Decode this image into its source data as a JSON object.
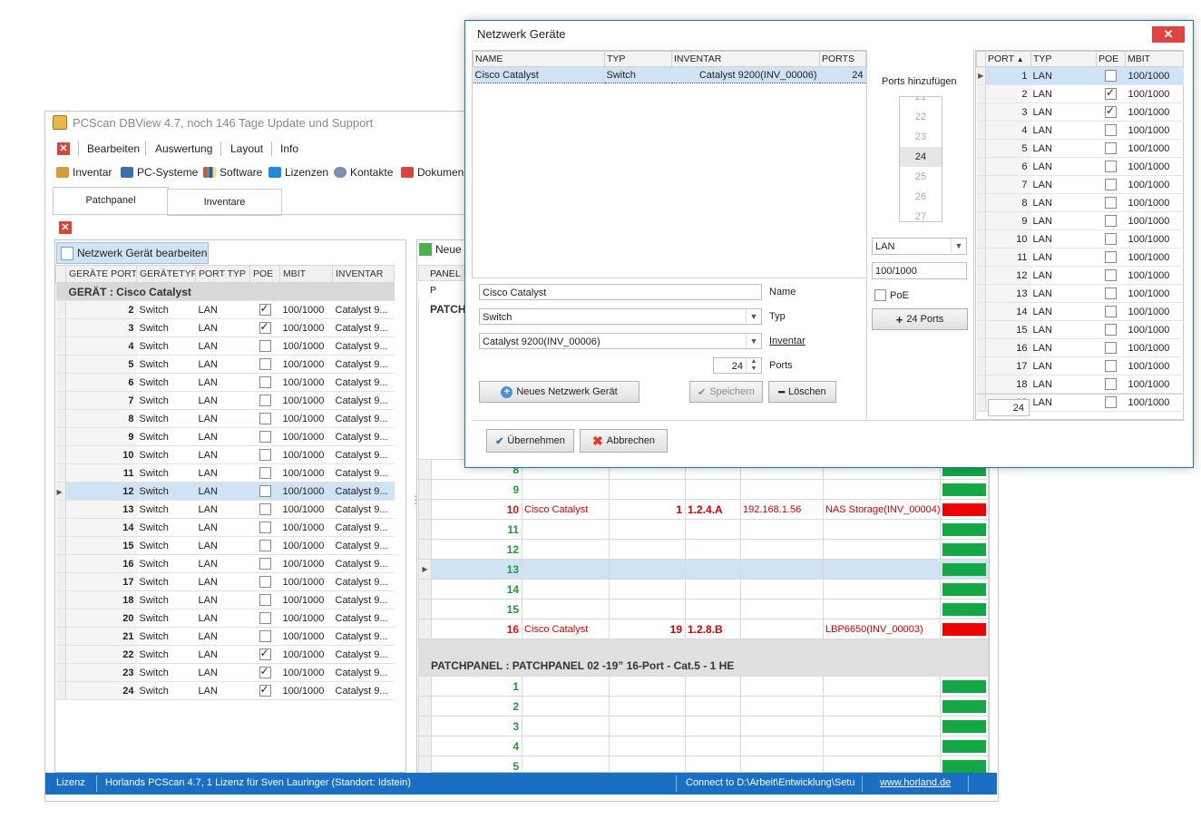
{
  "main": {
    "title": "PCScan DBView 4.7, noch 146 Tage Update und Support",
    "menu": [
      "Bearbeiten",
      "Auswertung",
      "Layout",
      "Info"
    ],
    "toolbar": [
      "Inventar",
      "PC-Systeme",
      "Software",
      "Lizenzen",
      "Kontakte",
      "Dokumen"
    ],
    "tabs": [
      "Patchpanel",
      "Inventare"
    ],
    "edit_button": "Netzwerk Gerät bearbeiten",
    "new_button": "Neue",
    "left_grid": {
      "columns": [
        "GERÄTE PORT",
        "GERÄTETYP",
        "PORT TYP",
        "POE",
        "MBIT",
        "INVENTAR"
      ],
      "group": "GERÄT : Cisco Catalyst",
      "rows": [
        {
          "port": "2",
          "type": "Switch",
          "ptype": "LAN",
          "poe": true,
          "mbit": "100/1000",
          "inv": "Catalyst 9..."
        },
        {
          "port": "3",
          "type": "Switch",
          "ptype": "LAN",
          "poe": true,
          "mbit": "100/1000",
          "inv": "Catalyst 9..."
        },
        {
          "port": "4",
          "type": "Switch",
          "ptype": "LAN",
          "poe": false,
          "mbit": "100/1000",
          "inv": "Catalyst 9..."
        },
        {
          "port": "5",
          "type": "Switch",
          "ptype": "LAN",
          "poe": false,
          "mbit": "100/1000",
          "inv": "Catalyst 9..."
        },
        {
          "port": "6",
          "type": "Switch",
          "ptype": "LAN",
          "poe": false,
          "mbit": "100/1000",
          "inv": "Catalyst 9..."
        },
        {
          "port": "7",
          "type": "Switch",
          "ptype": "LAN",
          "poe": false,
          "mbit": "100/1000",
          "inv": "Catalyst 9..."
        },
        {
          "port": "8",
          "type": "Switch",
          "ptype": "LAN",
          "poe": false,
          "mbit": "100/1000",
          "inv": "Catalyst 9..."
        },
        {
          "port": "9",
          "type": "Switch",
          "ptype": "LAN",
          "poe": false,
          "mbit": "100/1000",
          "inv": "Catalyst 9..."
        },
        {
          "port": "10",
          "type": "Switch",
          "ptype": "LAN",
          "poe": false,
          "mbit": "100/1000",
          "inv": "Catalyst 9..."
        },
        {
          "port": "11",
          "type": "Switch",
          "ptype": "LAN",
          "poe": false,
          "mbit": "100/1000",
          "inv": "Catalyst 9..."
        },
        {
          "port": "12",
          "type": "Switch",
          "ptype": "LAN",
          "poe": false,
          "mbit": "100/1000",
          "inv": "Catalyst 9...",
          "selected": true
        },
        {
          "port": "13",
          "type": "Switch",
          "ptype": "LAN",
          "poe": false,
          "mbit": "100/1000",
          "inv": "Catalyst 9..."
        },
        {
          "port": "14",
          "type": "Switch",
          "ptype": "LAN",
          "poe": false,
          "mbit": "100/1000",
          "inv": "Catalyst 9..."
        },
        {
          "port": "15",
          "type": "Switch",
          "ptype": "LAN",
          "poe": false,
          "mbit": "100/1000",
          "inv": "Catalyst 9..."
        },
        {
          "port": "16",
          "type": "Switch",
          "ptype": "LAN",
          "poe": false,
          "mbit": "100/1000",
          "inv": "Catalyst 9..."
        },
        {
          "port": "17",
          "type": "Switch",
          "ptype": "LAN",
          "poe": false,
          "mbit": "100/1000",
          "inv": "Catalyst 9..."
        },
        {
          "port": "18",
          "type": "Switch",
          "ptype": "LAN",
          "poe": false,
          "mbit": "100/1000",
          "inv": "Catalyst 9..."
        },
        {
          "port": "20",
          "type": "Switch",
          "ptype": "LAN",
          "poe": false,
          "mbit": "100/1000",
          "inv": "Catalyst 9..."
        },
        {
          "port": "21",
          "type": "Switch",
          "ptype": "LAN",
          "poe": false,
          "mbit": "100/1000",
          "inv": "Catalyst 9..."
        },
        {
          "port": "22",
          "type": "Switch",
          "ptype": "LAN",
          "poe": true,
          "mbit": "100/1000",
          "inv": "Catalyst 9..."
        },
        {
          "port": "23",
          "type": "Switch",
          "ptype": "LAN",
          "poe": true,
          "mbit": "100/1000",
          "inv": "Catalyst 9..."
        },
        {
          "port": "24",
          "type": "Switch",
          "ptype": "LAN",
          "poe": true,
          "mbit": "100/1000",
          "inv": "Catalyst 9..."
        }
      ]
    },
    "right_grid": {
      "header_first": "PANEL P",
      "group_partial": "PATCH",
      "rows": [
        {
          "num": "8",
          "device": "",
          "port": "",
          "name": "",
          "ip": "",
          "inv": "",
          "status": "green"
        },
        {
          "num": "9",
          "device": "",
          "port": "",
          "name": "",
          "ip": "",
          "inv": "",
          "status": "green"
        },
        {
          "num": "10",
          "device": "Cisco Catalyst",
          "port": "1",
          "name": "1.2.4.A",
          "ip": "192.168.1.56",
          "inv": "NAS Storage(INV_00004)",
          "status": "red"
        },
        {
          "num": "11",
          "device": "",
          "port": "",
          "name": "",
          "ip": "",
          "inv": "",
          "status": "green"
        },
        {
          "num": "12",
          "device": "",
          "port": "",
          "name": "",
          "ip": "",
          "inv": "",
          "status": "green"
        },
        {
          "num": "13",
          "device": "",
          "port": "",
          "name": "",
          "ip": "",
          "inv": "",
          "status": "green",
          "selected": true
        },
        {
          "num": "14",
          "device": "",
          "port": "",
          "name": "",
          "ip": "",
          "inv": "",
          "status": "green"
        },
        {
          "num": "15",
          "device": "",
          "port": "",
          "name": "",
          "ip": "",
          "inv": "",
          "status": "green"
        },
        {
          "num": "16",
          "device": "Cisco Catalyst",
          "port": "19",
          "name": "1.2.8.B",
          "ip": "",
          "inv": "LBP6650(INV_00003)",
          "status": "red"
        }
      ],
      "group2": "PATCHPANEL : PATCHPANEL 02 -19” 16-Port - Cat.5 - 1 HE",
      "rows2": [
        "1",
        "2",
        "3",
        "4",
        "5"
      ]
    },
    "status": {
      "license": "Lizenz",
      "text": "Horlands PCScan 4.7, 1 Lizenz für Sven Lauringer (Standort: Idstein)",
      "connect": "Connect to D:\\Arbeit\\Entwicklung\\Setu",
      "link": "www.horland.de"
    }
  },
  "dialog": {
    "title": "Netzwerk Geräte",
    "close": "✕",
    "grid_columns": [
      "NAME",
      "TYP",
      "INVENTAR",
      "PORTS"
    ],
    "grid_row": {
      "name": "Cisco Catalyst",
      "typ": "Switch",
      "inv": "Catalyst 9200(INV_00006)",
      "ports": "24"
    },
    "ports_label": "Ports hinzufügen",
    "ports_list": [
      "21",
      "22",
      "23",
      "24",
      "25",
      "26",
      "27"
    ],
    "ports_selected": "24",
    "type_combo": "LAN",
    "mbit_field": "100/1000",
    "poe_label": "PoE",
    "add_ports_button": "24 Ports",
    "form": {
      "name_value": "Cisco Catalyst",
      "name_label": "Name",
      "typ_value": "Switch",
      "typ_label": "Typ",
      "inv_value": "Catalyst 9200(INV_00006)",
      "inv_label": "Inventar",
      "ports_value": "24",
      "ports_label": "Ports"
    },
    "buttons": {
      "new": "Neues Netzwerk Gerät",
      "save": "Speichern",
      "delete": "Löschen",
      "accept": "Übernehmen",
      "cancel": "Abbrechen"
    },
    "port_grid": {
      "columns": [
        "PORT",
        "TYP",
        "POE",
        "MBIT"
      ],
      "rows": [
        {
          "port": "1",
          "typ": "LAN",
          "poe": false,
          "mbit": "100/1000",
          "selected": true
        },
        {
          "port": "2",
          "typ": "LAN",
          "poe": true,
          "mbit": "100/1000"
        },
        {
          "port": "3",
          "typ": "LAN",
          "poe": true,
          "mbit": "100/1000"
        },
        {
          "port": "4",
          "typ": "LAN",
          "poe": false,
          "mbit": "100/1000"
        },
        {
          "port": "5",
          "typ": "LAN",
          "poe": false,
          "mbit": "100/1000"
        },
        {
          "port": "6",
          "typ": "LAN",
          "poe": false,
          "mbit": "100/1000"
        },
        {
          "port": "7",
          "typ": "LAN",
          "poe": false,
          "mbit": "100/1000"
        },
        {
          "port": "8",
          "typ": "LAN",
          "poe": false,
          "mbit": "100/1000"
        },
        {
          "port": "9",
          "typ": "LAN",
          "poe": false,
          "mbit": "100/1000"
        },
        {
          "port": "10",
          "typ": "LAN",
          "poe": false,
          "mbit": "100/1000"
        },
        {
          "port": "11",
          "typ": "LAN",
          "poe": false,
          "mbit": "100/1000"
        },
        {
          "port": "12",
          "typ": "LAN",
          "poe": false,
          "mbit": "100/1000"
        },
        {
          "port": "13",
          "typ": "LAN",
          "poe": false,
          "mbit": "100/1000"
        },
        {
          "port": "14",
          "typ": "LAN",
          "poe": false,
          "mbit": "100/1000"
        },
        {
          "port": "15",
          "typ": "LAN",
          "poe": false,
          "mbit": "100/1000"
        },
        {
          "port": "16",
          "typ": "LAN",
          "poe": false,
          "mbit": "100/1000"
        },
        {
          "port": "17",
          "typ": "LAN",
          "poe": false,
          "mbit": "100/1000"
        },
        {
          "port": "18",
          "typ": "LAN",
          "poe": false,
          "mbit": "100/1000"
        },
        {
          "port": "19",
          "typ": "LAN",
          "poe": false,
          "mbit": "100/1000"
        }
      ],
      "footer_count": "24"
    }
  }
}
